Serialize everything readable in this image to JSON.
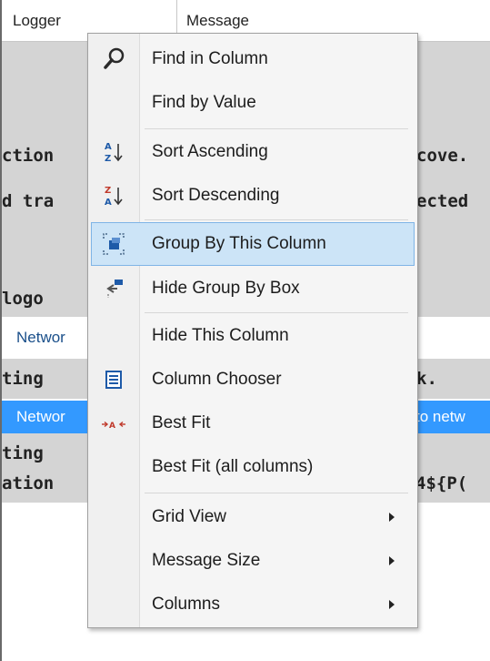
{
  "grid": {
    "columns": [
      "Logger",
      "Message"
    ],
    "rows": [
      {
        "style": "gray",
        "logger": "",
        "message": "",
        "font": "mono"
      },
      {
        "style": "gray",
        "logger": "",
        "message": "",
        "font": "mono"
      },
      {
        "style": "gray",
        "logger": "ction",
        "message": "cove.",
        "font": "mono"
      },
      {
        "style": "gray",
        "logger": "d tra",
        "message": "ected",
        "font": "mono"
      },
      {
        "style": "gray",
        "logger": "",
        "message": "",
        "font": "mono"
      },
      {
        "style": "gray",
        "logger": "",
        "message": "",
        "font": "mono"
      },
      {
        "style": "gray",
        "logger": " logo",
        "message": "",
        "font": "mono"
      },
      {
        "style": "white",
        "logger": "Networ",
        "message": "",
        "font": "plain"
      },
      {
        "style": "gray",
        "logger": "ting ",
        "message": "k.",
        "font": "mono"
      },
      {
        "style": "sel",
        "logger": "Networ",
        "message": "to netw",
        "font": "plain"
      },
      {
        "style": "gray",
        "logger": "ting ",
        "message": "",
        "font": "mono"
      },
      {
        "style": "gray",
        "logger": "ation",
        "message": "4${P(",
        "font": "mono"
      }
    ]
  },
  "menu": {
    "items": [
      {
        "label": "Find in Column",
        "icon": "search-icon"
      },
      {
        "label": "Find by Value",
        "icon": ""
      },
      {
        "label": "Sort Ascending",
        "icon": "sort-ascending-icon"
      },
      {
        "label": "Sort Descending",
        "icon": "sort-descending-icon"
      },
      {
        "label": "Group By This Column",
        "icon": "group-by-column-icon",
        "highlighted": true
      },
      {
        "label": "Hide Group By Box",
        "icon": "hide-group-box-icon"
      },
      {
        "label": "Hide This Column",
        "icon": ""
      },
      {
        "label": "Column Chooser",
        "icon": "column-chooser-icon"
      },
      {
        "label": "Best Fit",
        "icon": "best-fit-icon"
      },
      {
        "label": "Best Fit (all columns)",
        "icon": ""
      },
      {
        "label": "Grid View",
        "icon": "",
        "submenu": true
      },
      {
        "label": "Message Size",
        "icon": "",
        "submenu": true
      },
      {
        "label": "Columns",
        "icon": "",
        "submenu": true
      }
    ]
  },
  "colors": {
    "highlight": "#cce4f7",
    "highlight_border": "#7fb4e6",
    "selection": "#3399ff",
    "row_gray": "#d4d4d4",
    "icon_blue": "#1e5aa8"
  }
}
